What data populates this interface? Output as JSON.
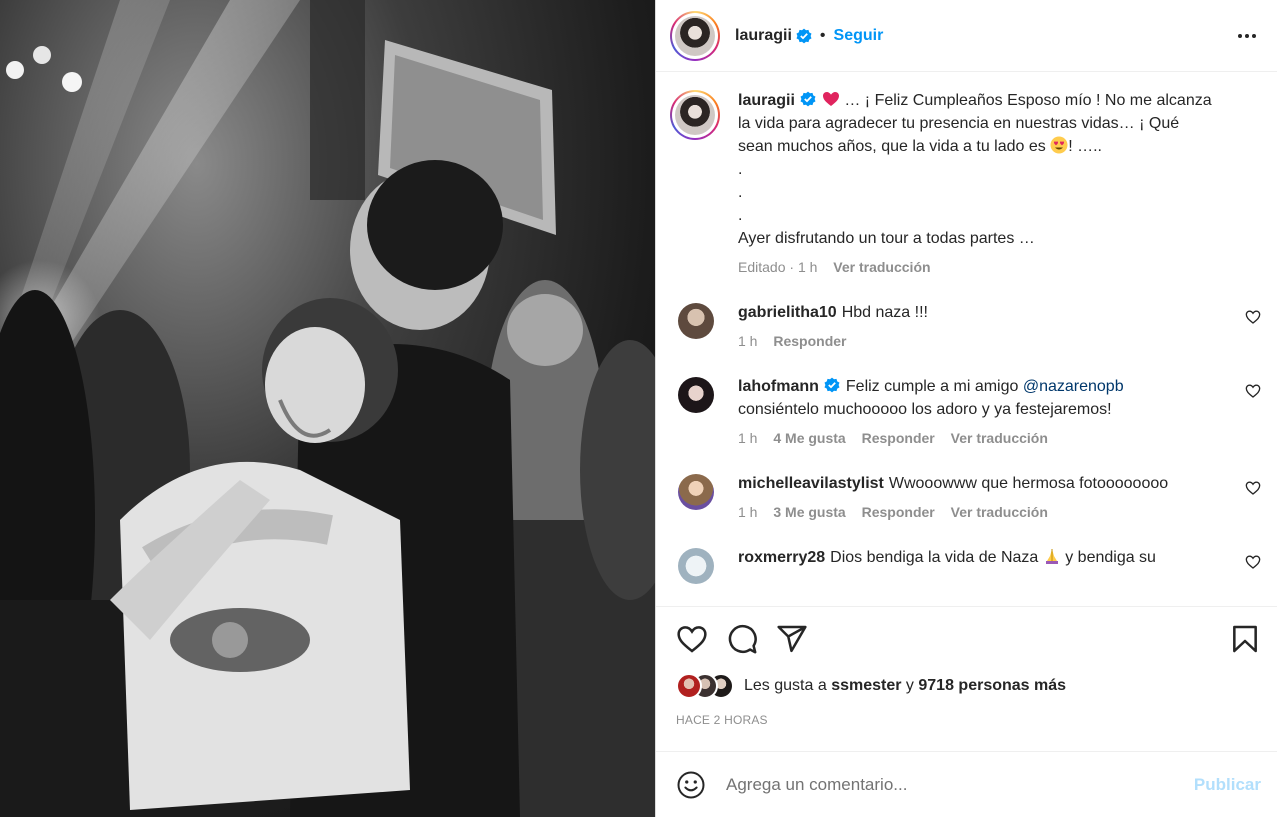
{
  "header": {
    "username": "lauragii",
    "follow_label": "Seguir",
    "separator": "•"
  },
  "caption": {
    "username": "lauragii",
    "lines": [
      "… ¡ Feliz Cumpleaños Esposo mío ! No me alcanza",
      "la vida para agradecer tu presencia en nuestras vidas… ¡ Qué",
      "sean muchos años, que la vida a tu lado es",
      "! …..",
      ".",
      ".",
      ".",
      "Ayer disfrutando un tour a todas partes …"
    ],
    "meta_edited": "Editado",
    "meta_sep": "·",
    "meta_time": "1 h",
    "translate_label": "Ver traducción"
  },
  "comments": [
    {
      "username": "gabrielitha10",
      "text": "Hbd naza !!!",
      "time": "1 h",
      "likes": "",
      "reply_label": "Responder",
      "translate_label": "",
      "avatar_color": "#7d6a5c"
    },
    {
      "username": "lahofmann",
      "text_before": "Feliz cumple a mi amigo",
      "mention": "@nazarenopb",
      "text_after": "consiéntelo muchooooo los adoro y ya festejaremos!",
      "time": "1 h",
      "likes": "4 Me gusta",
      "reply_label": "Responder",
      "translate_label": "Ver traducción",
      "avatar_color": "#2a1f22"
    },
    {
      "username": "michelleavilastylist",
      "text": "Wwooowww que hermosa fotoooooooo",
      "time": "1 h",
      "likes": "3 Me gusta",
      "reply_label": "Responder",
      "translate_label": "Ver traducción",
      "avatar_color": "#a58a6a"
    },
    {
      "username": "roxmerry28",
      "text_before": "Dios bendiga la vida de Naza",
      "text_after": "y bendiga su",
      "avatar_color": "#c9d6de"
    }
  ],
  "actions": {
    "likes_prefix": "Les gusta a",
    "likes_user": "ssmester",
    "likes_and": "y",
    "likes_count": "9718 personas más",
    "time_ago": "HACE 2 HORAS"
  },
  "add_comment": {
    "placeholder": "Agrega un comentario...",
    "publish_label": "Publicar"
  },
  "colors": {
    "accent": "#0095f6",
    "publish_disabled": "#b2dffc",
    "verified": "#0095f6"
  }
}
